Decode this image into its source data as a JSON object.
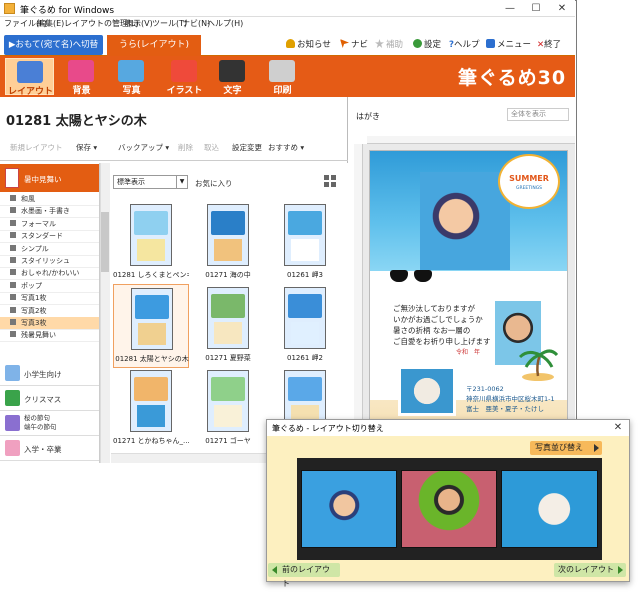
{
  "window": {
    "title": "筆ぐるめ for Windows",
    "controls": {
      "minimize": "—",
      "maximize": "☐",
      "close": "✕"
    }
  },
  "menubar": [
    "ファイル(F)",
    "編集(E)",
    "レイアウトの管理(L)",
    "表示(V)",
    "ツール(T)",
    "ナビ(N)",
    "ヘルプ(H)"
  ],
  "mode_tabs": {
    "front": "▶おもて(宛て名)へ切替",
    "back": "うら(レイアウト)"
  },
  "top_tools": [
    {
      "label": "お知らせ",
      "icon": "bell-icon",
      "color": "#e0a000",
      "enabled": true
    },
    {
      "label": "ナビ",
      "icon": "pointer-icon",
      "color": "#e06000",
      "enabled": true
    },
    {
      "label": "補助",
      "icon": "star-icon",
      "color": "#bbbbbb",
      "enabled": false
    },
    {
      "label": "設定",
      "icon": "gear-icon",
      "color": "#3a9a3a",
      "enabled": true
    },
    {
      "label": "ヘルプ",
      "icon": "help-icon",
      "color": "#2c6fcf",
      "enabled": true
    },
    {
      "label": "メニュー",
      "icon": "menu-icon",
      "color": "#2c6fcf",
      "enabled": true
    },
    {
      "label": "終了",
      "icon": "exit-icon",
      "color": "#d02020",
      "enabled": true
    }
  ],
  "ribbon": {
    "brand": "筆ぐるめ30",
    "buttons": [
      {
        "label": "レイアウト",
        "icon": "layout-icon",
        "color": "#4a7fd6",
        "selected": true
      },
      {
        "label": "背景",
        "icon": "background-icon",
        "color": "#e84a8a",
        "selected": false
      },
      {
        "label": "写真",
        "icon": "photo-icon",
        "color": "#57a8e0",
        "selected": false
      },
      {
        "label": "イラスト",
        "icon": "illustration-icon",
        "color": "#ef4a3a",
        "selected": false
      },
      {
        "label": "文字",
        "icon": "text-icon",
        "color": "#333333",
        "selected": false
      },
      {
        "label": "印刷",
        "icon": "printer-icon",
        "color": "#cfcfcf",
        "selected": false
      }
    ]
  },
  "layout_panel": {
    "title": "01281 太陽とヤシの木",
    "toolbar": [
      {
        "label": "新規レイアウト",
        "enabled": false
      },
      {
        "label": "保存 ▾",
        "enabled": true
      },
      {
        "label": "バックアップ ▾",
        "enabled": true
      },
      {
        "label": "削除",
        "enabled": false
      },
      {
        "label": "取込",
        "enabled": false
      },
      {
        "label": "設定変更",
        "enabled": true
      },
      {
        "label": "おすすめ ▾",
        "enabled": true
      }
    ],
    "view_select": "標準表示",
    "favorites": "お気に入り"
  },
  "categories": {
    "header": "暑中見舞い",
    "subitems": [
      {
        "label": "和風",
        "selected": false
      },
      {
        "label": "水墨画・手書き",
        "selected": false
      },
      {
        "label": "フォーマル",
        "selected": false
      },
      {
        "label": "スタンダード",
        "selected": false
      },
      {
        "label": "シンプル",
        "selected": false
      },
      {
        "label": "スタイリッシュ",
        "selected": false
      },
      {
        "label": "おしゃれ/かわいい",
        "selected": false
      },
      {
        "label": "ポップ",
        "selected": false
      },
      {
        "label": "写真1枚",
        "selected": false
      },
      {
        "label": "写真2枚",
        "selected": false
      },
      {
        "label": "写真3枚",
        "selected": true
      },
      {
        "label": "残暑見舞い",
        "selected": false
      }
    ],
    "groups": [
      {
        "label": "小学生向け",
        "color": "#7fb3e8"
      },
      {
        "label": "クリスマス",
        "color": "#3aa34a"
      },
      {
        "label": "桜の節句\n端午の節句",
        "color": "#8a6fd0"
      },
      {
        "label": "入学・卒業",
        "color": "#f0a0c0"
      }
    ]
  },
  "templates": [
    {
      "caption": "01281 しろくまとペンギ...",
      "c1": "#8fd0f0",
      "c2": "#f5e6a0",
      "selected": false
    },
    {
      "caption": "01271 海の中",
      "c1": "#2a7fc8",
      "c2": "#f1c27d",
      "selected": false
    },
    {
      "caption": "01261 岬3",
      "c1": "#4aa8e0",
      "c2": "#ffffff",
      "selected": false
    },
    {
      "caption": "01281 太陽とヤシの木",
      "c1": "#3d9be0",
      "c2": "#f0d090",
      "selected": true
    },
    {
      "caption": "01271 夏野菜",
      "c1": "#7ab86a",
      "c2": "#f7e7c0",
      "selected": false
    },
    {
      "caption": "01261 岬2",
      "c1": "#3a8ed8",
      "c2": "#e0f0ff",
      "selected": false
    },
    {
      "caption": "01271 とかねちゃん_...",
      "c1": "#f1b56a",
      "c2": "#3a9ad8",
      "selected": false
    },
    {
      "caption": "01271 ゴーヤ",
      "c1": "#8fd08a",
      "c2": "#f9f1d8",
      "selected": false
    },
    {
      "caption": "",
      "c1": "#5aa8e8",
      "c2": "#f5e0b0",
      "selected": false
    }
  ],
  "preview": {
    "label": "はがき",
    "display": "全体を表示",
    "summer_title": "SUMMER",
    "summer_sub": "GREETINGS",
    "message": [
      "ご無沙汰しておりますが",
      "いかがお過ごしでしょうか",
      "暑さの折柄 なお一層の",
      "ご自愛をお祈り申し上げます"
    ],
    "signature": "令和　年",
    "address": [
      "〒231-0062",
      "神奈川県横浜市中区桜木町1-1",
      "富士　亜美・夏子・たけし"
    ]
  },
  "dialog": {
    "title": "筆ぐるめ - レイアウト切り替え",
    "close": "✕",
    "swap_button": "写真並び替え",
    "prev_button": "前のレイアウト",
    "next_button": "次のレイアウト"
  }
}
